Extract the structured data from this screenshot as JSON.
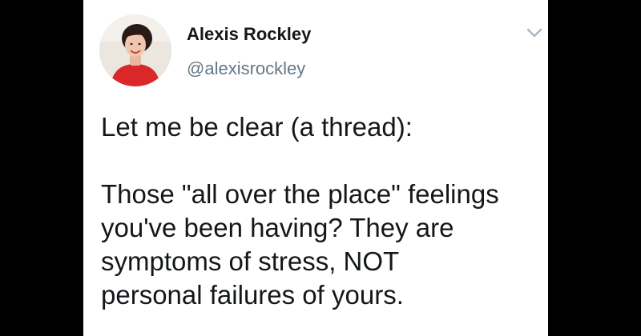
{
  "author": {
    "display_name": "Alexis Rockley",
    "handle": "@alexisrockley",
    "avatar_icon": "profile-photo"
  },
  "menu": {
    "icon": "chevron-down-icon"
  },
  "tweet": {
    "paragraphs": [
      "Let me be clear (a thread):",
      "Those \"all over the place\" feelings\nyou've been having? They are\nsymptoms of stress, NOT\npersonal failures of yours."
    ]
  },
  "colors": {
    "background": "#000000",
    "card": "#ffffff",
    "text": "#14171a",
    "handle": "#657786",
    "shirt": "#d9272a"
  }
}
